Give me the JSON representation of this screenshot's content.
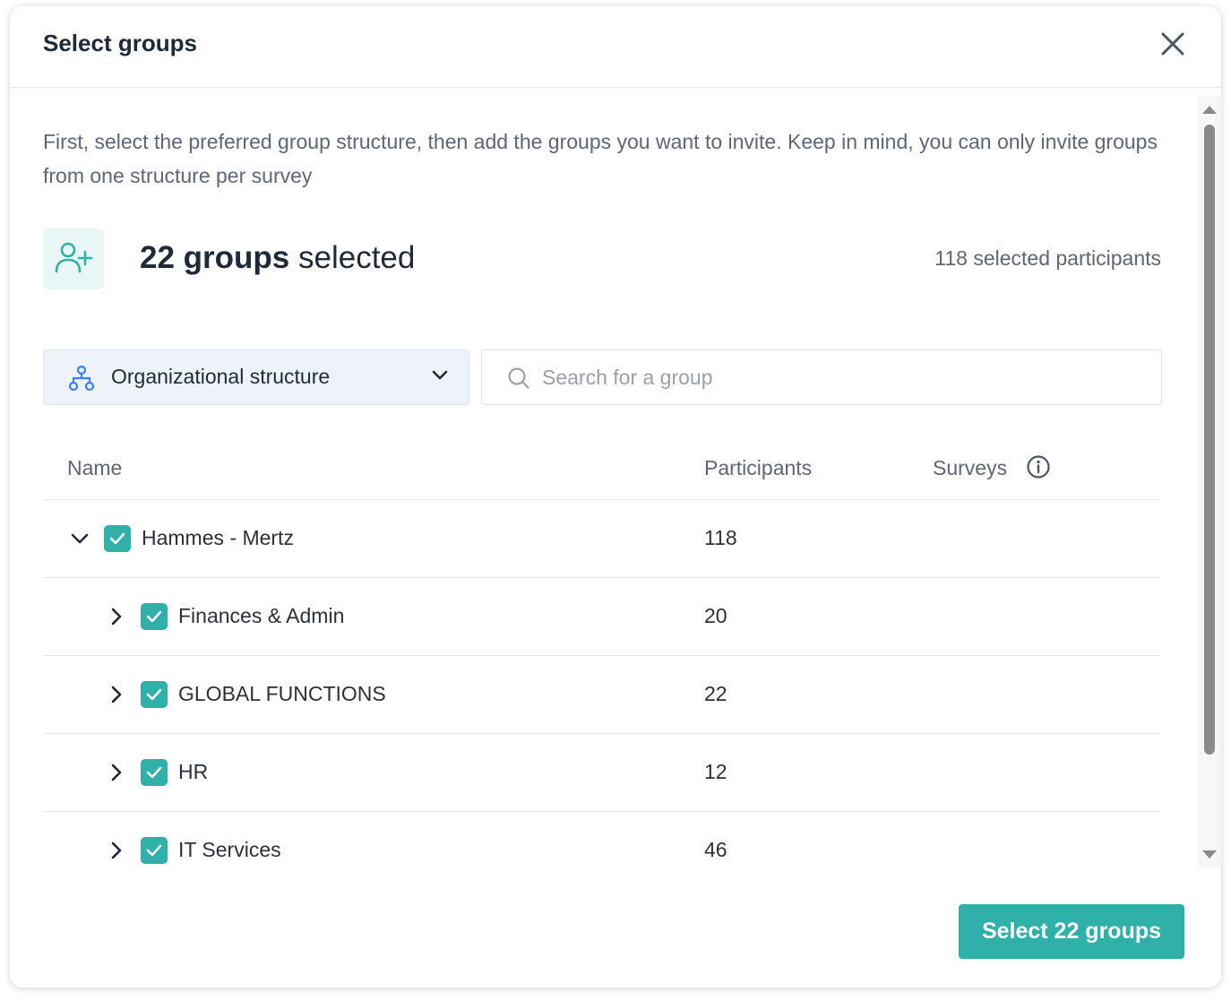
{
  "modal": {
    "title": "Select groups"
  },
  "intro_text": "First, select the preferred group structure, then add the groups you want to invite. Keep in mind, you can only invite groups from one structure per survey",
  "summary": {
    "count_label": "22 groups",
    "suffix": "selected",
    "participants_label": "118 selected participants"
  },
  "structure_select": {
    "value": "Organizational structure"
  },
  "search": {
    "placeholder": "Search for a group"
  },
  "table": {
    "headers": {
      "name": "Name",
      "participants": "Participants",
      "surveys": "Surveys"
    },
    "rows": [
      {
        "name": "Hammes - Mertz",
        "participants": "118",
        "expanded": true,
        "level": 0,
        "checked": true
      },
      {
        "name": "Finances & Admin",
        "participants": "20",
        "expanded": false,
        "level": 1,
        "checked": true
      },
      {
        "name": "GLOBAL FUNCTIONS",
        "participants": "22",
        "expanded": false,
        "level": 1,
        "checked": true
      },
      {
        "name": "HR",
        "participants": "12",
        "expanded": false,
        "level": 1,
        "checked": true
      },
      {
        "name": "IT Services",
        "participants": "46",
        "expanded": false,
        "level": 1,
        "checked": true
      }
    ]
  },
  "footer": {
    "primary_label": "Select 22 groups"
  },
  "colors": {
    "accent": "#2fb0a8",
    "accent_light": "#e8f6f5",
    "select_bg": "#eef3fa",
    "icon_blue": "#3b82f6"
  }
}
